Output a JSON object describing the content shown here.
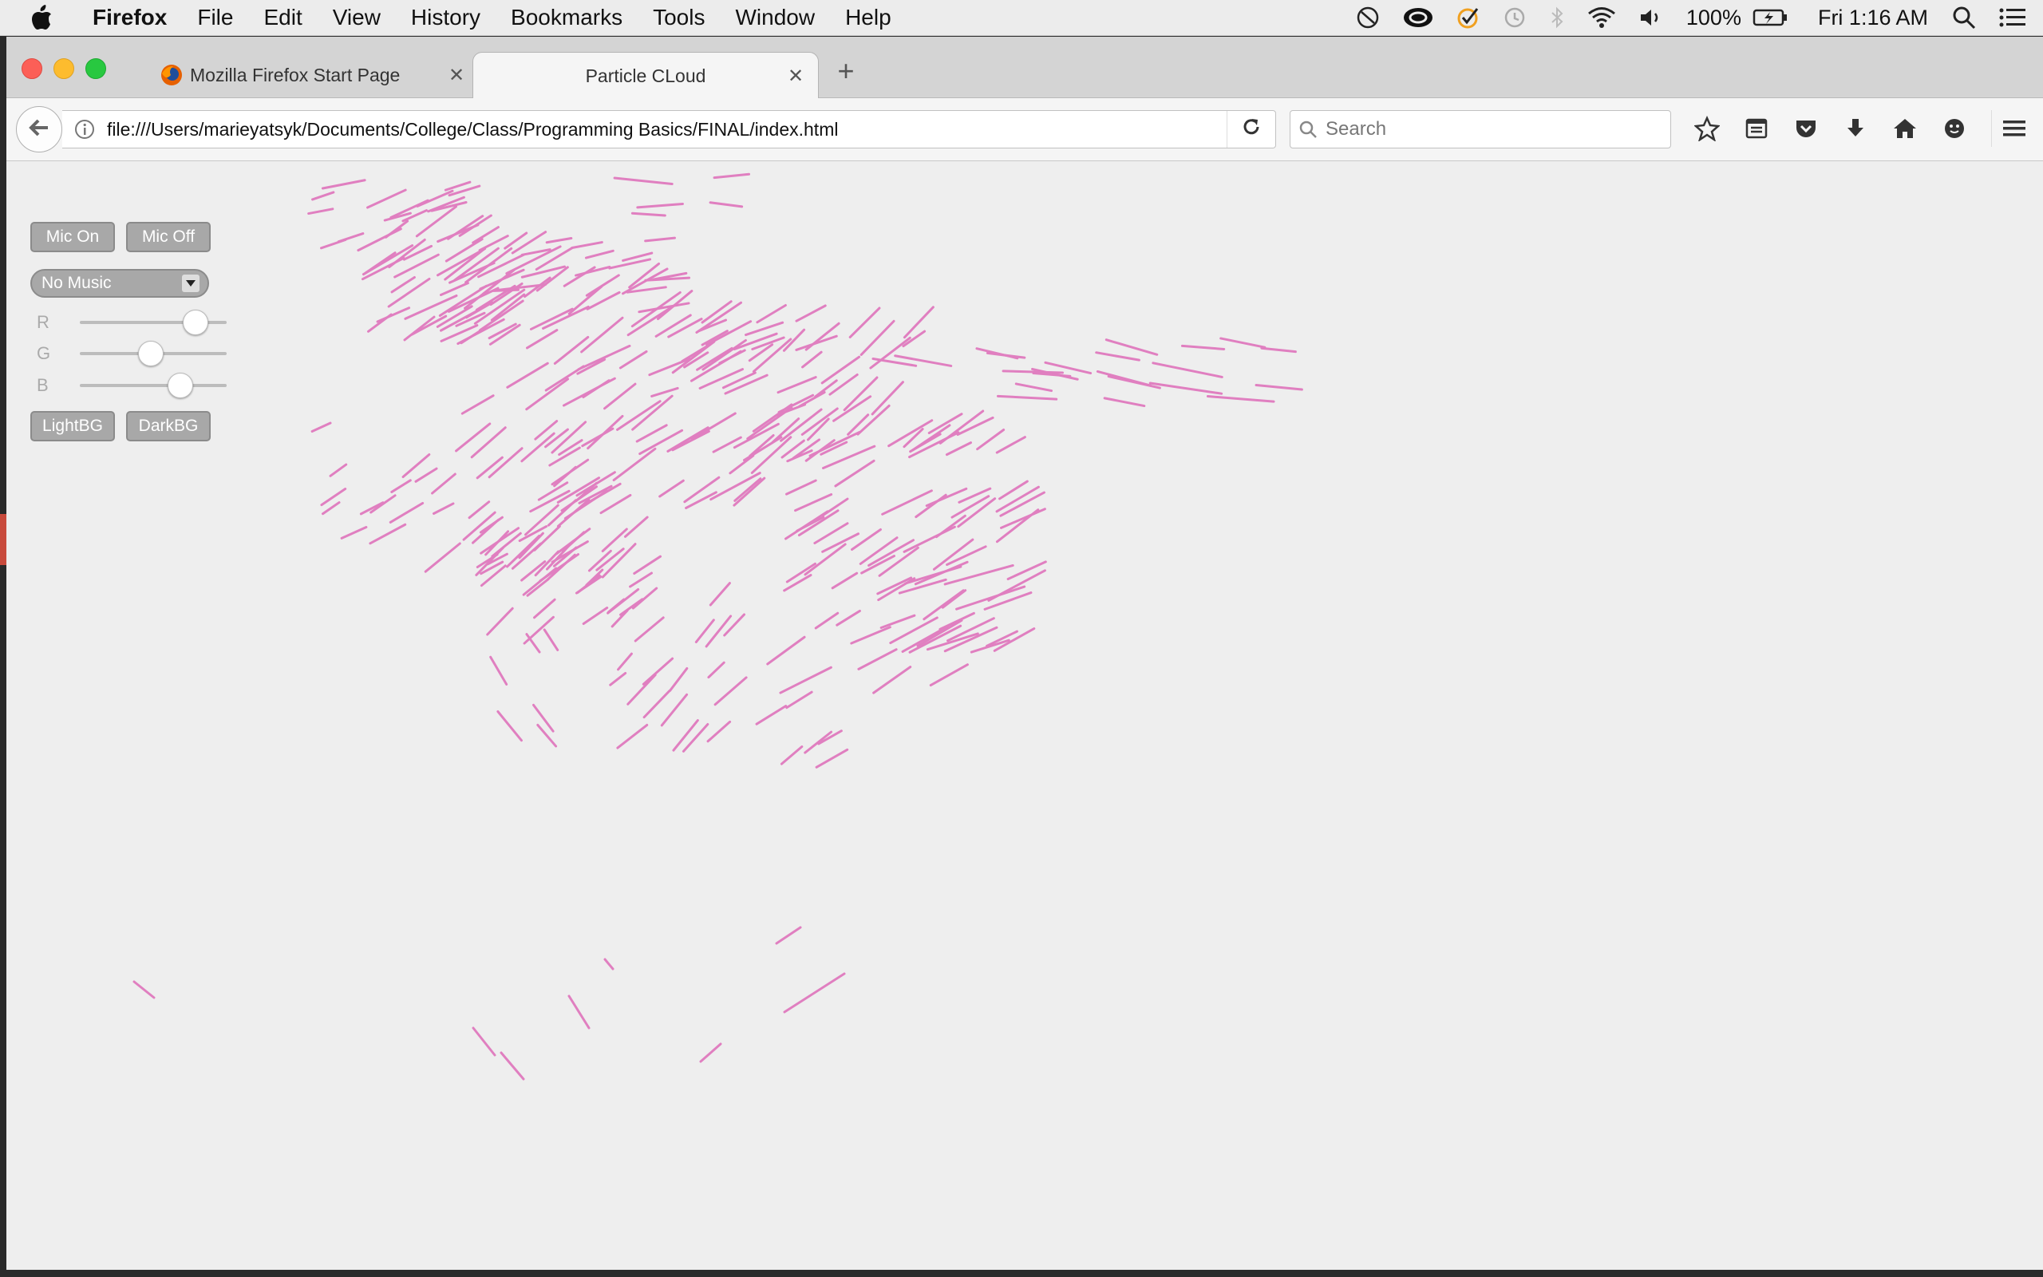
{
  "menubar": {
    "app": "Firefox",
    "items": [
      "File",
      "Edit",
      "View",
      "History",
      "Bookmarks",
      "Tools",
      "Window",
      "Help"
    ],
    "battery": "100%",
    "clock": "Fri 1:16 AM"
  },
  "tabs": [
    {
      "label": "Mozilla Firefox Start Page",
      "active": false
    },
    {
      "label": "Particle CLoud",
      "active": true
    }
  ],
  "tab_close_glyph": "✕",
  "new_tab_glyph": "+",
  "navbar": {
    "url": "file:///Users/marieyatsyk/Documents/College/Class/Programming Basics/FINAL/index.html",
    "search_placeholder": "Search"
  },
  "controls": {
    "mic_on": "Mic On",
    "mic_off": "Mic Off",
    "music_selected": "No Music",
    "sliders": [
      {
        "label": "R",
        "value": 0.78
      },
      {
        "label": "G",
        "value": 0.48
      },
      {
        "label": "B",
        "value": 0.68
      }
    ],
    "light_bg": "LightBG",
    "dark_bg": "DarkBG"
  },
  "particle_color": "#e07fc0",
  "icons": [
    "apple-icon",
    "firefox-icon",
    "back-arrow-icon",
    "info-icon",
    "reload-icon",
    "search-icon",
    "bookmark-star-icon",
    "reading-list-icon",
    "pocket-icon",
    "download-icon",
    "home-icon",
    "emoji-icon",
    "hamburger-menu-icon"
  ]
}
